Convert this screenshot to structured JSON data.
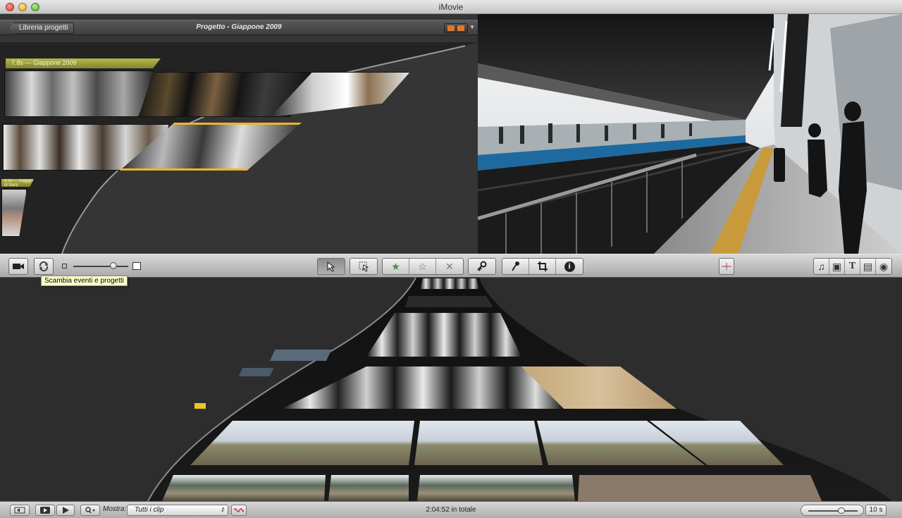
{
  "window": {
    "title": "iMovie"
  },
  "project": {
    "back_label": "Libreria progetti",
    "name": "Progetto - Giappone 2009",
    "clip_title": "7.8s — Giappone 2009",
    "clip_title_small": "4.3s — Viaggio di Nara"
  },
  "toolbar": {
    "tooltip": "Scambia eventi e progetti",
    "buttons": {
      "camera": "camera-import-icon",
      "swap": "swap-events-projects-icon",
      "arrow": "arrow-select-icon",
      "hand": "hand-drag-icon",
      "favorite": "★",
      "unmark": "☆",
      "reject": "✕",
      "keyword": "key-icon",
      "voiceover": "microphone-icon",
      "crop": "crop-icon",
      "info": "i"
    },
    "browsers": [
      "♫",
      "▣",
      "T",
      "▤",
      "◉"
    ]
  },
  "bottom": {
    "mostra_label": "Mostra:",
    "filter_value": "Tutti i clip",
    "select_arrow": "⇕",
    "total": "2:04:52 in totale",
    "thumb_duration": "10 s"
  },
  "colors": {
    "clip_title": "#9a9a3c",
    "selection": "#f0b430",
    "meter": "#4cd24c"
  }
}
